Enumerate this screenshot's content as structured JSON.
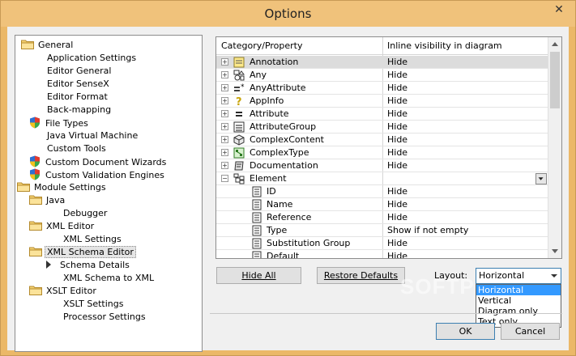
{
  "window": {
    "title": "Options",
    "close_glyph": "✕"
  },
  "tree": {
    "items": [
      {
        "label": "General",
        "icon": "folder-open-icon"
      },
      {
        "label": "Application Settings"
      },
      {
        "label": "Editor General"
      },
      {
        "label": "Editor SenseX"
      },
      {
        "label": "Editor Format"
      },
      {
        "label": "Back-mapping"
      },
      {
        "label": "File Types",
        "icon": "shield-icon"
      },
      {
        "label": "Java Virtual Machine"
      },
      {
        "label": "Custom Tools"
      },
      {
        "label": "Custom Document Wizards",
        "icon": "shield-icon"
      },
      {
        "label": "Custom Validation Engines",
        "icon": "shield-icon"
      },
      {
        "label": "Module Settings",
        "icon": "folder-open-icon"
      },
      {
        "label": "Java",
        "icon": "folder-open-icon"
      },
      {
        "label": "Debugger"
      },
      {
        "label": "XML Editor",
        "icon": "folder-open-icon"
      },
      {
        "label": "XML Settings"
      },
      {
        "label": "XML Schema Editor",
        "icon": "folder-open-icon",
        "selected": true
      },
      {
        "label": "Schema Details",
        "icon": "arrow-icon"
      },
      {
        "label": "XML Schema to XML"
      },
      {
        "label": "XSLT Editor",
        "icon": "folder-open-icon"
      },
      {
        "label": "XSLT Settings"
      },
      {
        "label": "Processor Settings"
      }
    ]
  },
  "grid": {
    "col1_header": "Category/Property",
    "col2_header": "Inline visibility in diagram",
    "rows": [
      {
        "name": "Annotation",
        "value": "Hide",
        "icon": "annotation-icon"
      },
      {
        "name": "Any",
        "value": "Hide",
        "icon": "any-icon"
      },
      {
        "name": "AnyAttribute",
        "value": "Hide",
        "icon": "any-attribute-icon"
      },
      {
        "name": "AppInfo",
        "value": "Hide",
        "icon": "appinfo-icon"
      },
      {
        "name": "Attribute",
        "value": "Hide",
        "icon": "attribute-icon"
      },
      {
        "name": "AttributeGroup",
        "value": "Hide",
        "icon": "attribute-group-icon"
      },
      {
        "name": "ComplexContent",
        "value": "Hide",
        "icon": "complex-content-icon"
      },
      {
        "name": "ComplexType",
        "value": "Hide",
        "icon": "complex-type-icon"
      },
      {
        "name": "Documentation",
        "value": "Hide",
        "icon": "documentation-icon"
      },
      {
        "name": "Element",
        "value": "",
        "icon": "element-icon"
      },
      {
        "name": "ID",
        "value": "Hide",
        "icon": "property-icon"
      },
      {
        "name": "Name",
        "value": "Hide",
        "icon": "property-icon"
      },
      {
        "name": "Reference",
        "value": "Hide",
        "icon": "property-icon"
      },
      {
        "name": "Type",
        "value": "Show if not empty",
        "icon": "property-icon"
      },
      {
        "name": "Substitution Group",
        "value": "Hide",
        "icon": "property-icon"
      },
      {
        "name": "Default",
        "value": "Hide",
        "icon": "property-icon"
      }
    ]
  },
  "buttons": {
    "hide_all": "Hide All",
    "restore_defaults": "Restore Defaults",
    "ok": "OK",
    "cancel": "Cancel"
  },
  "layout": {
    "label": "Layout:",
    "selected": "Horizontal",
    "options": [
      "Horizontal",
      "Vertical",
      "Diagram only",
      "Text only"
    ]
  },
  "watermark": "SOFTPEDIA",
  "colors": {
    "titlebar": "#f0c27b",
    "selection": "#3399ff"
  }
}
